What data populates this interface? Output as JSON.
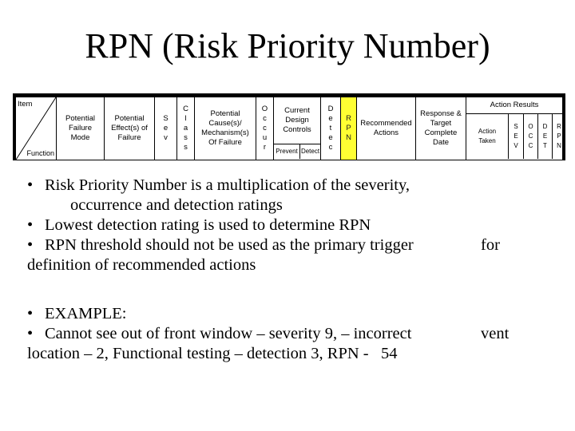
{
  "title": "RPN (Risk Priority Number)",
  "table": {
    "item_label": "Item",
    "function_label": "Function",
    "potential_failure_mode": [
      "Potential",
      "Failure",
      "Mode"
    ],
    "potential_effects": [
      "Potential",
      "Effect(s) of",
      "Failure"
    ],
    "sev": [
      "S",
      "e",
      "v"
    ],
    "class": [
      "C",
      "l",
      "a",
      "s",
      "s"
    ],
    "potential_causes": [
      "Potential",
      "Cause(s)/",
      "Mechanism(s)",
      "Of Failure"
    ],
    "occur": [
      "O",
      "c",
      "c",
      "u",
      "r"
    ],
    "current_design_controls": [
      "Current",
      "Design",
      "Controls"
    ],
    "prevent_label": "Prevent",
    "detect_label": "Detect",
    "detec": [
      "D",
      "e",
      "t",
      "e",
      "c"
    ],
    "rpn": [
      "R",
      "P",
      "N"
    ],
    "recommended_actions": [
      "Recommended",
      "Actions"
    ],
    "response_target": [
      "Response &",
      "Target",
      "Complete",
      "Date"
    ],
    "action_results_label": "Action Results",
    "action_taken": [
      "Action",
      "Taken"
    ],
    "res_sev": [
      "S",
      "E",
      "V"
    ],
    "res_occ": [
      "O",
      "C",
      "C"
    ],
    "res_det": [
      "D",
      "E",
      "T"
    ],
    "res_rpn": [
      "R",
      "P",
      "N"
    ],
    "highlight_color": "#ffff33"
  },
  "bullets": [
    {
      "bullet": "•",
      "text": "Risk Priority Number is a multiplication of the severity,",
      "continuation": "occurrence and detection ratings"
    },
    {
      "bullet": "•",
      "text": "Lowest detection rating is used to determine RPN"
    },
    {
      "bullet": "•",
      "text": "RPN threshold should not be used as the primary trigger",
      "trailing": "for",
      "wrap": "definition of recommended actions"
    },
    {
      "bullet": "•",
      "text": "EXAMPLE:"
    },
    {
      "bullet": "•",
      "text": "Cannot see out of front window – severity 9, – incorrect",
      "trailing": "vent",
      "wrap": "location – 2, Functional testing – detection 3, RPN -   54"
    }
  ]
}
